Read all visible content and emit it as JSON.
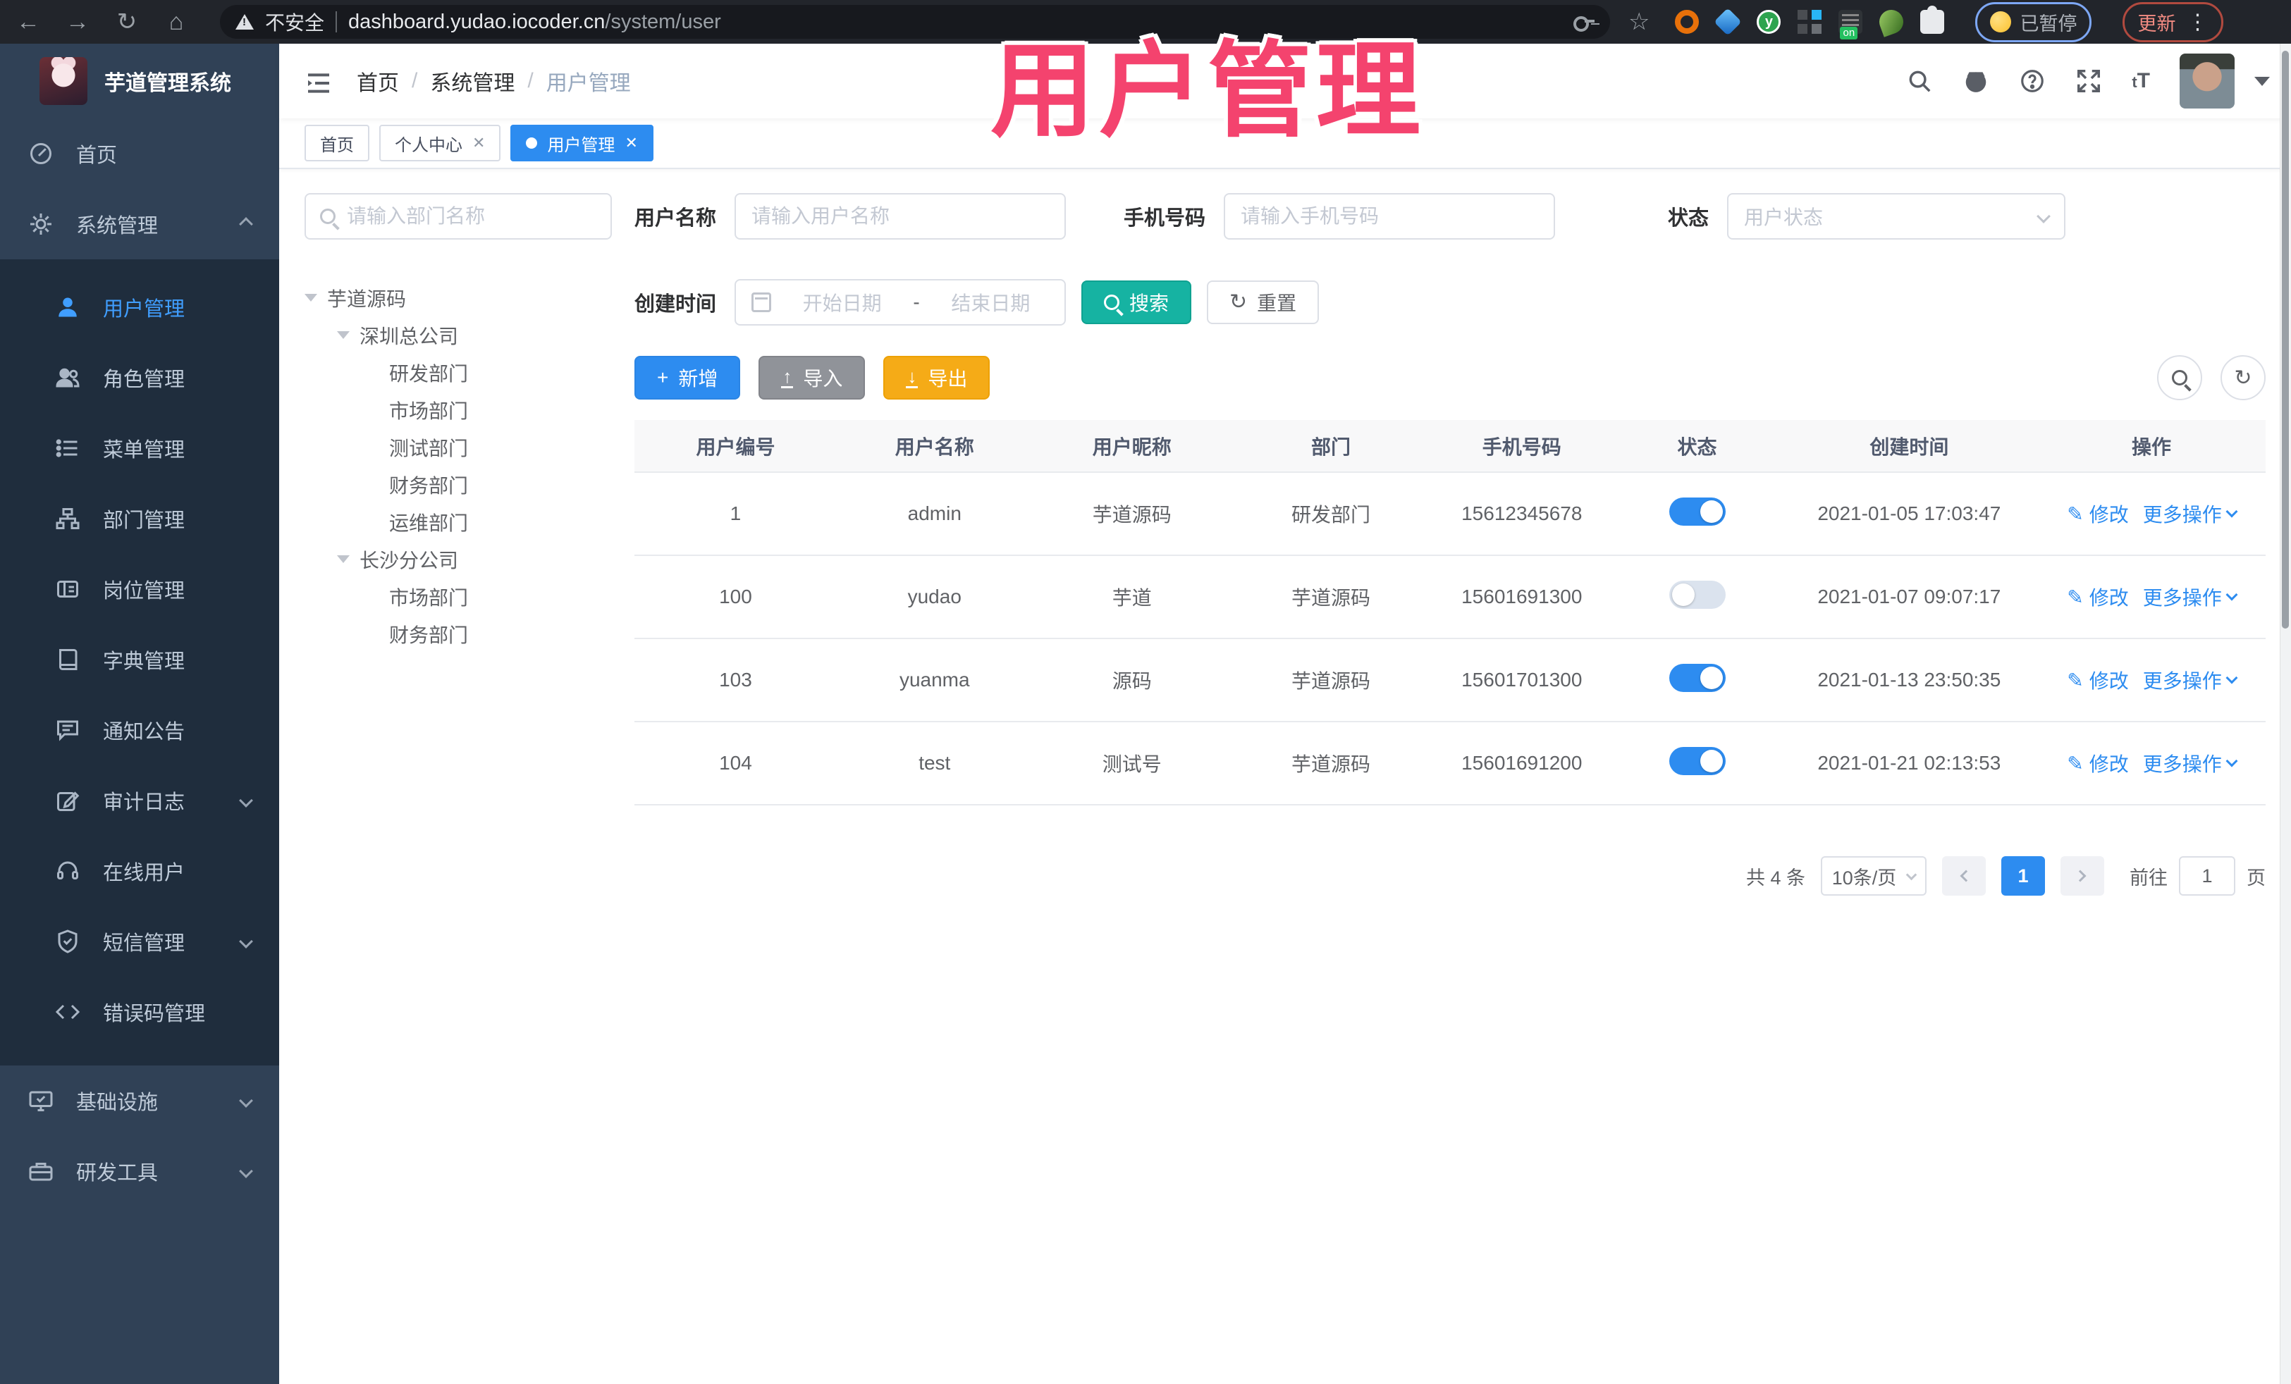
{
  "browser": {
    "security_label": "不安全",
    "url_host": "dashboard.yudao.iocoder.cn",
    "url_path": "/system/user",
    "paused_badge": "已暂停",
    "update_button": "更新"
  },
  "overlay": {
    "title": "用户管理",
    "color": "#f4436e"
  },
  "header": {
    "logo_title": "芋道管理系统",
    "breadcrumb": [
      "首页",
      "系统管理",
      "用户管理"
    ],
    "icons": [
      "search-icon",
      "github-icon",
      "help-icon",
      "fullscreen-icon",
      "font-size-icon",
      "avatar",
      "caret-down-icon"
    ]
  },
  "tabs": [
    {
      "label": "首页",
      "closable": false,
      "active": false
    },
    {
      "label": "个人中心",
      "closable": true,
      "active": false
    },
    {
      "label": "用户管理",
      "closable": true,
      "active": true
    }
  ],
  "sidebar": {
    "items": [
      {
        "label": "首页",
        "icon": "dashboard-icon"
      },
      {
        "label": "系统管理",
        "icon": "gear-icon",
        "chevron": "up"
      },
      {
        "label": "用户管理",
        "icon": "user-icon",
        "active": true
      },
      {
        "label": "角色管理",
        "icon": "users-icon"
      },
      {
        "label": "菜单管理",
        "icon": "menu-list-icon"
      },
      {
        "label": "部门管理",
        "icon": "org-tree-icon"
      },
      {
        "label": "岗位管理",
        "icon": "id-card-icon"
      },
      {
        "label": "字典管理",
        "icon": "book-icon"
      },
      {
        "label": "通知公告",
        "icon": "message-icon"
      },
      {
        "label": "审计日志",
        "icon": "edit-log-icon",
        "chevron": "down"
      },
      {
        "label": "在线用户",
        "icon": "headset-icon"
      },
      {
        "label": "短信管理",
        "icon": "shield-icon",
        "chevron": "down"
      },
      {
        "label": "错误码管理",
        "icon": "code-icon"
      },
      {
        "label": "基础设施",
        "icon": "monitor-icon",
        "chevron": "down"
      },
      {
        "label": "研发工具",
        "icon": "toolbox-icon",
        "chevron": "down"
      }
    ]
  },
  "tree": {
    "search_placeholder": "请输入部门名称",
    "nodes": [
      {
        "label": "芋道源码",
        "level": 0,
        "expanded": true
      },
      {
        "label": "深圳总公司",
        "level": 1,
        "expanded": true
      },
      {
        "label": "研发部门",
        "level": 2
      },
      {
        "label": "市场部门",
        "level": 2
      },
      {
        "label": "测试部门",
        "level": 2
      },
      {
        "label": "财务部门",
        "level": 2
      },
      {
        "label": "运维部门",
        "level": 2
      },
      {
        "label": "长沙分公司",
        "level": 1,
        "expanded": true
      },
      {
        "label": "市场部门",
        "level": 2
      },
      {
        "label": "财务部门",
        "level": 2
      }
    ]
  },
  "filters": {
    "username_label": "用户名称",
    "username_placeholder": "请输入用户名称",
    "mobile_label": "手机号码",
    "mobile_placeholder": "请输入手机号码",
    "status_label": "状态",
    "status_placeholder": "用户状态",
    "created_label": "创建时间",
    "date_start": "开始日期",
    "date_separator": "-",
    "date_end": "结束日期",
    "search_button": "搜索",
    "reset_button": "重置"
  },
  "toolbar": {
    "add_button": "新增",
    "import_button": "导入",
    "export_button": "导出"
  },
  "table": {
    "columns": [
      "用户编号",
      "用户名称",
      "用户昵称",
      "部门",
      "手机号码",
      "状态",
      "创建时间",
      "操作"
    ],
    "edit_label": "修改",
    "more_label": "更多操作",
    "rows": [
      {
        "id": "1",
        "username": "admin",
        "nickname": "芋道源码",
        "dept": "研发部门",
        "mobile": "15612345678",
        "status_on": true,
        "created": "2021-01-05 17:03:47"
      },
      {
        "id": "100",
        "username": "yudao",
        "nickname": "芋道",
        "dept": "芋道源码",
        "mobile": "15601691300",
        "status_on": false,
        "created": "2021-01-07 09:07:17"
      },
      {
        "id": "103",
        "username": "yuanma",
        "nickname": "源码",
        "dept": "芋道源码",
        "mobile": "15601701300",
        "status_on": true,
        "created": "2021-01-13 23:50:35"
      },
      {
        "id": "104",
        "username": "test",
        "nickname": "测试号",
        "dept": "芋道源码",
        "mobile": "15601691200",
        "status_on": true,
        "created": "2021-01-21 02:13:53"
      }
    ]
  },
  "pagination": {
    "total_label": "共 4 条",
    "page_size": "10条/页",
    "current_page": "1",
    "goto_label": "前往",
    "goto_value": "1",
    "page_unit": "页"
  }
}
